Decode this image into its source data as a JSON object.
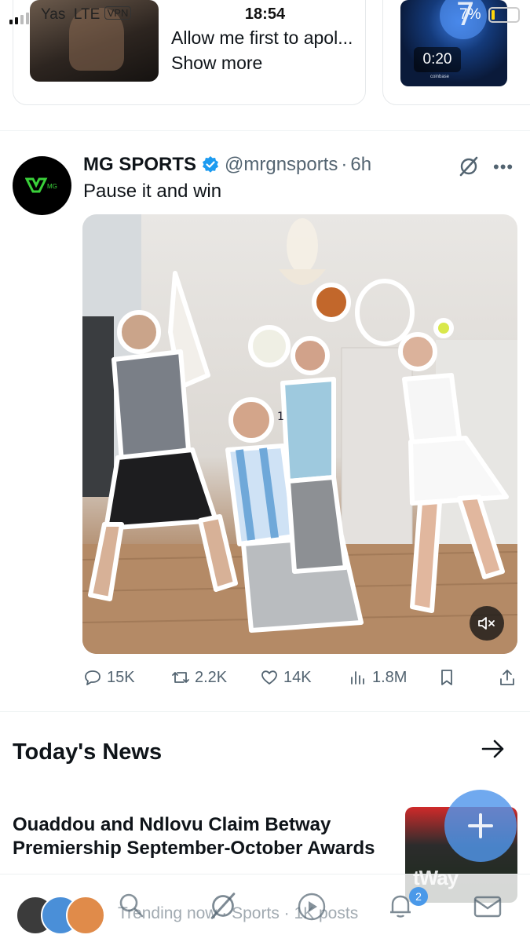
{
  "status_bar": {
    "carrier": "Yas",
    "network": "LTE",
    "vpn": "VPN",
    "time": "18:54",
    "battery": "7%"
  },
  "carousel": {
    "card_text": "Allow me first to apol... Show more",
    "video_duration": "0:20",
    "video_caption": "coinbase"
  },
  "tweet": {
    "name": "MG SPORTS",
    "handle": "@mrgnsports",
    "separator": "·",
    "time": "6h",
    "text": "Pause it and win",
    "avatar_logo": "MG",
    "replies": "15K",
    "reposts": "2.2K",
    "likes": "14K",
    "views": "1.8M",
    "player_digits": "1"
  },
  "news": {
    "section_title": "Today's News",
    "headline": "Ouaddou and Ndlovu Claim Betway Premiership September-October Awards",
    "thumb_text": "tWay"
  },
  "bottom_bar": {
    "trending": "Trending now · Sports · 1K posts",
    "notification_count": "2"
  },
  "colors": {
    "verified": "#1d9bf0",
    "fab": "#4a99e9",
    "text_secondary": "#536471"
  },
  "icons": [
    "grok-icon",
    "more-icon",
    "reply-icon",
    "repost-icon",
    "like-icon",
    "views-icon",
    "bookmark-icon",
    "share-icon",
    "mute-icon",
    "arrow-right-icon",
    "home-icon",
    "search-icon",
    "grok-tab-icon",
    "video-tab-icon",
    "bell-icon",
    "mail-icon"
  ]
}
